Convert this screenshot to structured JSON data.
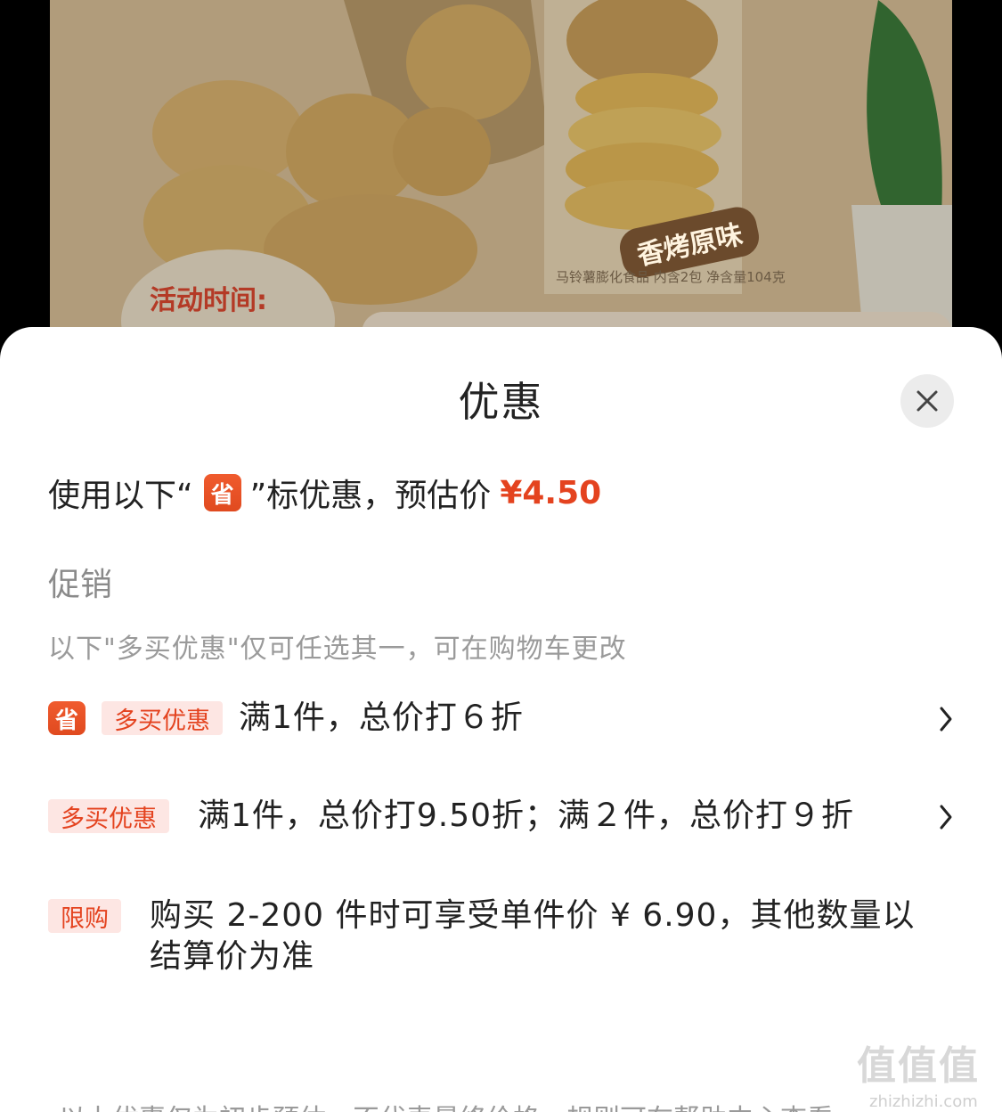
{
  "hero": {
    "activity_label": "活动时间:",
    "flavor_label": "香烤原味",
    "package_info": "马铃薯膨化食品 内含2包 净含量104克"
  },
  "sheet": {
    "title": "优惠",
    "close_icon": "close-icon",
    "estimate": {
      "prefix": "使用以下“",
      "badge": "省",
      "suffix": "”标优惠，预估价",
      "price": "¥4.50"
    },
    "section_title": "促销",
    "section_note": "以下\"多买优惠\"仅可任选其一，可在购物车更改",
    "promotions": [
      {
        "badge": "省",
        "tag": "多买优惠",
        "text": "满1件，总价打６折"
      },
      {
        "tag": "多买优惠",
        "text": "满1件，总价打9.50折；满２件，总价打９折"
      },
      {
        "tag": "限购",
        "text": "购买 2-200 件时可享受单件价 ¥ 6.90，其他数量以结算价为准"
      }
    ],
    "footer_note": "以上优惠仅为初步预估，不代表最终价格，规则可在帮助中心查看"
  },
  "watermark": {
    "glyphs": "值值值",
    "url": "zhizhizhi.com"
  },
  "colors": {
    "accent": "#e4431f",
    "tag_bg": "#fde6e3",
    "text": "#222222",
    "muted": "#9a9a9a"
  }
}
